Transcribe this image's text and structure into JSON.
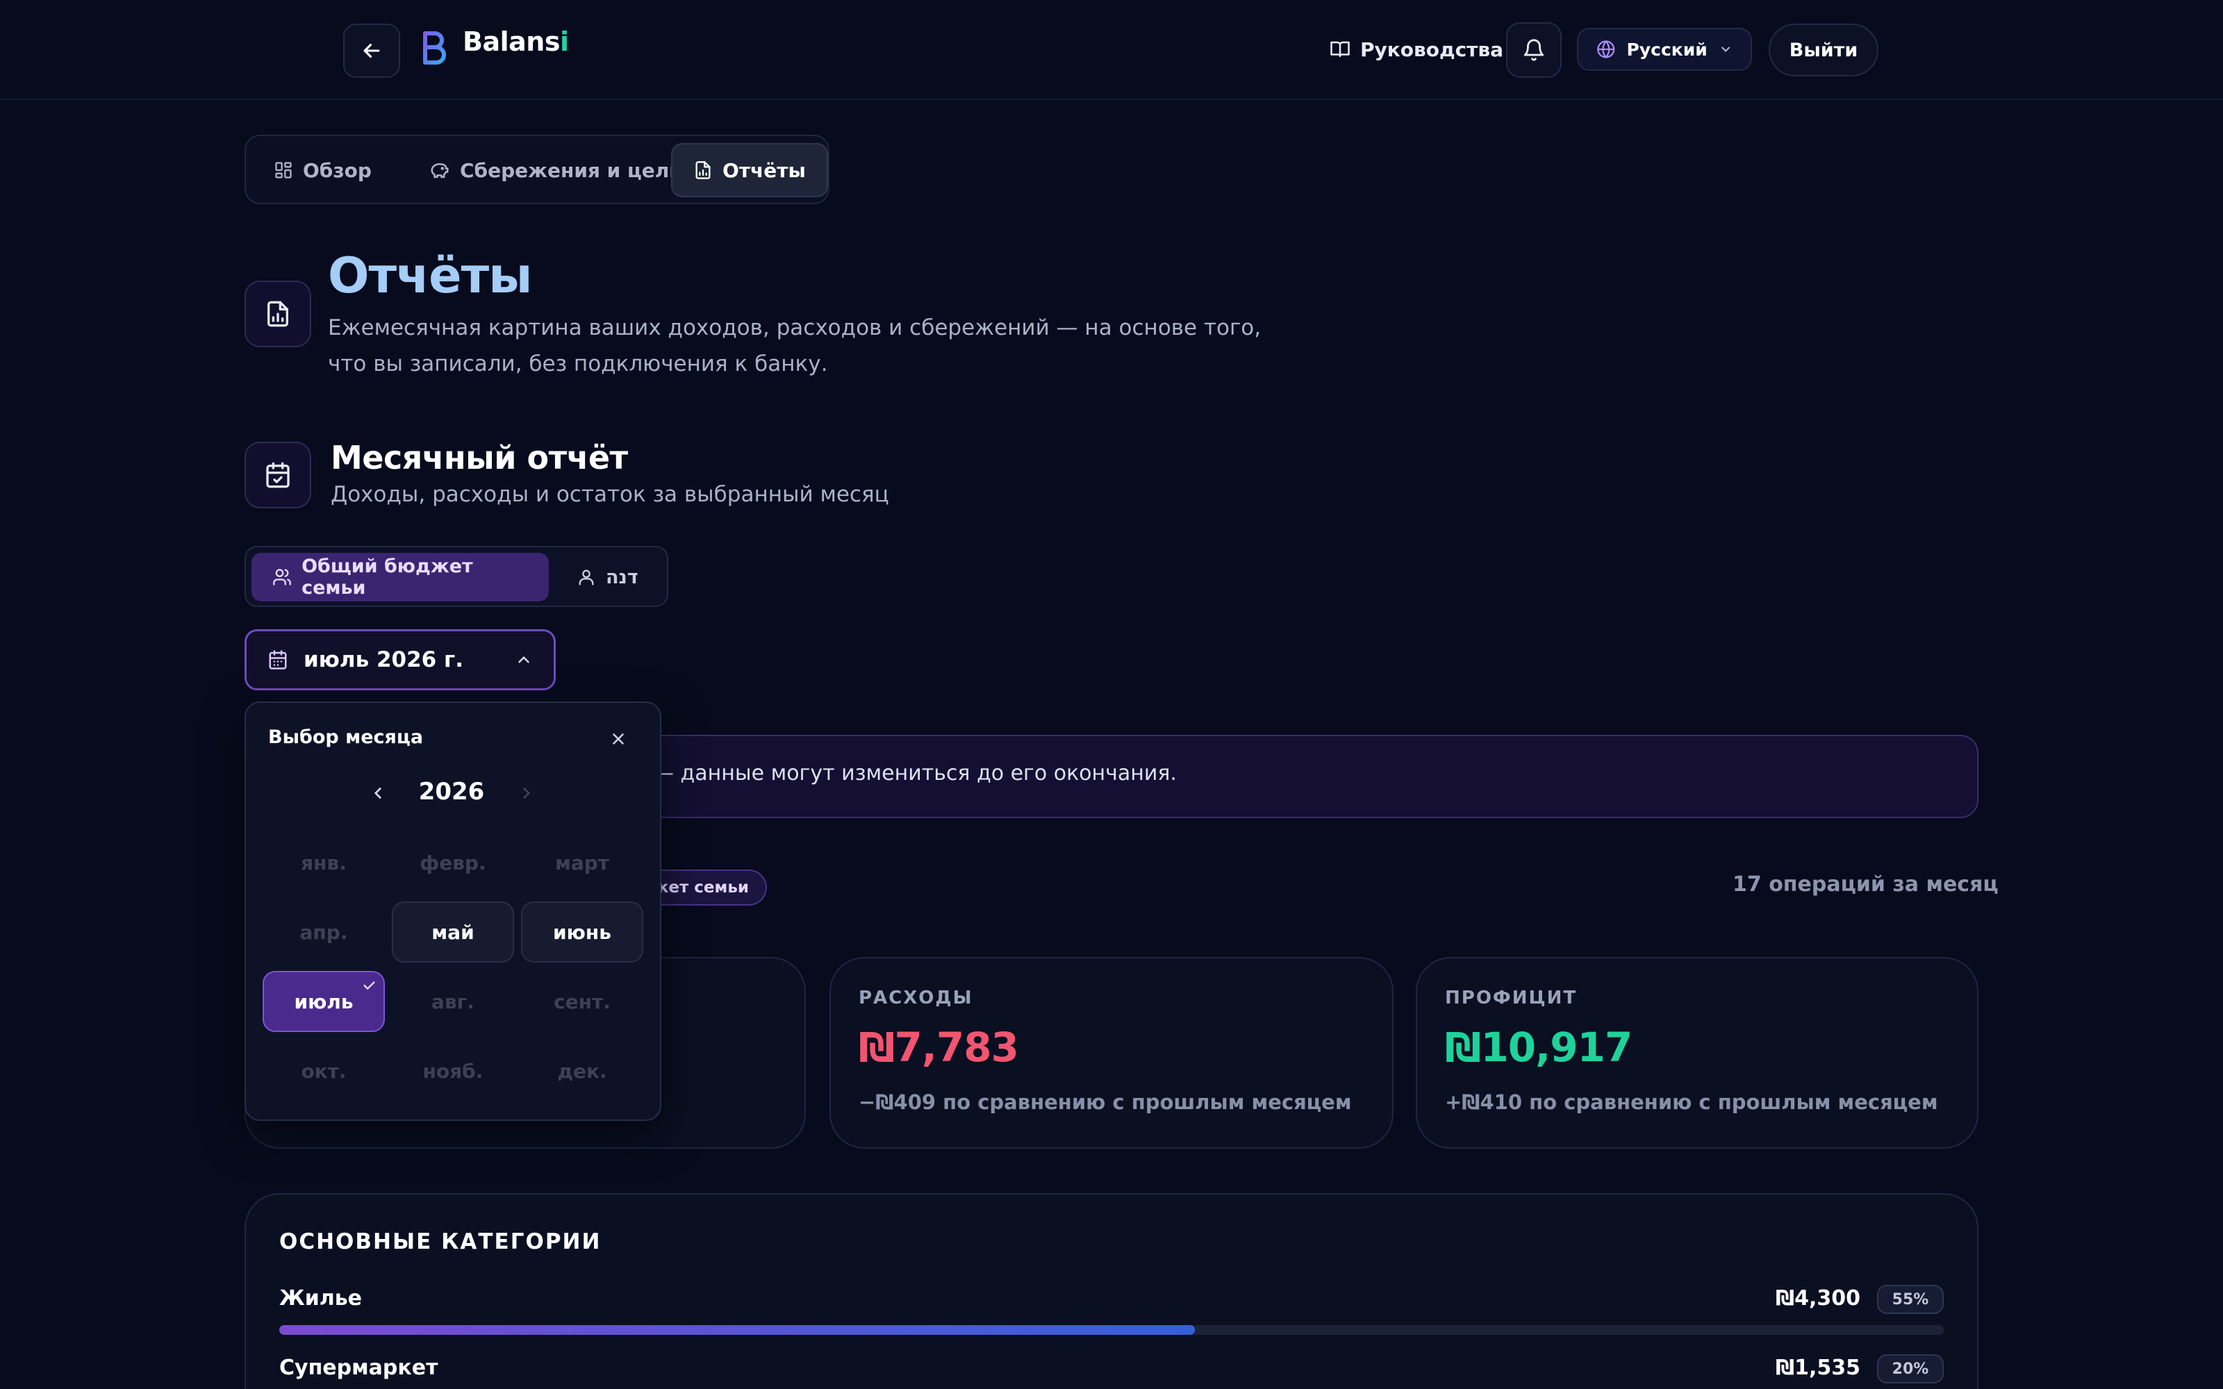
{
  "header": {
    "logo_text": "Balans",
    "logo_accent": "i",
    "guides_label": "Руководства",
    "language_label": "Русский",
    "logout_label": "Выйти"
  },
  "tabs": [
    {
      "label": "Обзор",
      "icon": "grid-icon",
      "active": false
    },
    {
      "label": "Сбережения и цели",
      "icon": "piggy-bank-icon",
      "active": false
    },
    {
      "label": "Отчёты",
      "icon": "report-icon",
      "active": true
    }
  ],
  "page": {
    "title": "Отчёты",
    "description": "Ежемесячная картина ваших доходов, расходов и сбережений — на основе того, что вы записали, без подключения к банку."
  },
  "section": {
    "title": "Месячный отчёт",
    "description": "Доходы, расходы и остаток за выбранный месяц"
  },
  "scope": {
    "family_label": "Общий бюджет семьи",
    "person_label": "דנה"
  },
  "month_select": {
    "value": "июль 2026 г."
  },
  "banner": {
    "text": "— данные могут измениться до его окончания."
  },
  "scope_badge": "жет семьи",
  "operations_count": "17 операций за месяц",
  "cards": {
    "expenses": {
      "label": "РАСХОДЫ",
      "value": "₪7,783",
      "sub": "−₪409 по сравнению с прошлым месяцем"
    },
    "surplus": {
      "label": "ПРОФИЦИТ",
      "value": "₪10,917",
      "sub": "+₪410 по сравнению с прошлым месяцем"
    }
  },
  "categories": {
    "title": "ОСНОВНЫЕ КАТЕГОРИИ",
    "items": [
      {
        "name": "Жилье",
        "amount": "₪4,300",
        "percent": "55%",
        "share": 0.55
      },
      {
        "name": "Супермаркет",
        "amount": "₪1,535",
        "percent": "20%",
        "share": 0.2
      }
    ]
  },
  "picker": {
    "title": "Выбор месяца",
    "year": "2026",
    "months": [
      {
        "label": "янв.",
        "state": "disabled"
      },
      {
        "label": "февр.",
        "state": "disabled"
      },
      {
        "label": "март",
        "state": "disabled"
      },
      {
        "label": "апр.",
        "state": "disabled"
      },
      {
        "label": "май",
        "state": "enabled"
      },
      {
        "label": "июнь",
        "state": "enabled"
      },
      {
        "label": "июль",
        "state": "selected"
      },
      {
        "label": "авг.",
        "state": "disabled"
      },
      {
        "label": "сент.",
        "state": "disabled"
      },
      {
        "label": "окт.",
        "state": "disabled"
      },
      {
        "label": "нояб.",
        "state": "disabled"
      },
      {
        "label": "дек.",
        "state": "disabled"
      }
    ]
  },
  "colors": {
    "background": "#070b1d",
    "accent_purple": "#4a2a8c",
    "expense_red": "#f2556f",
    "surplus_green": "#1ed39a",
    "title_blue": "#a5cdf8"
  }
}
